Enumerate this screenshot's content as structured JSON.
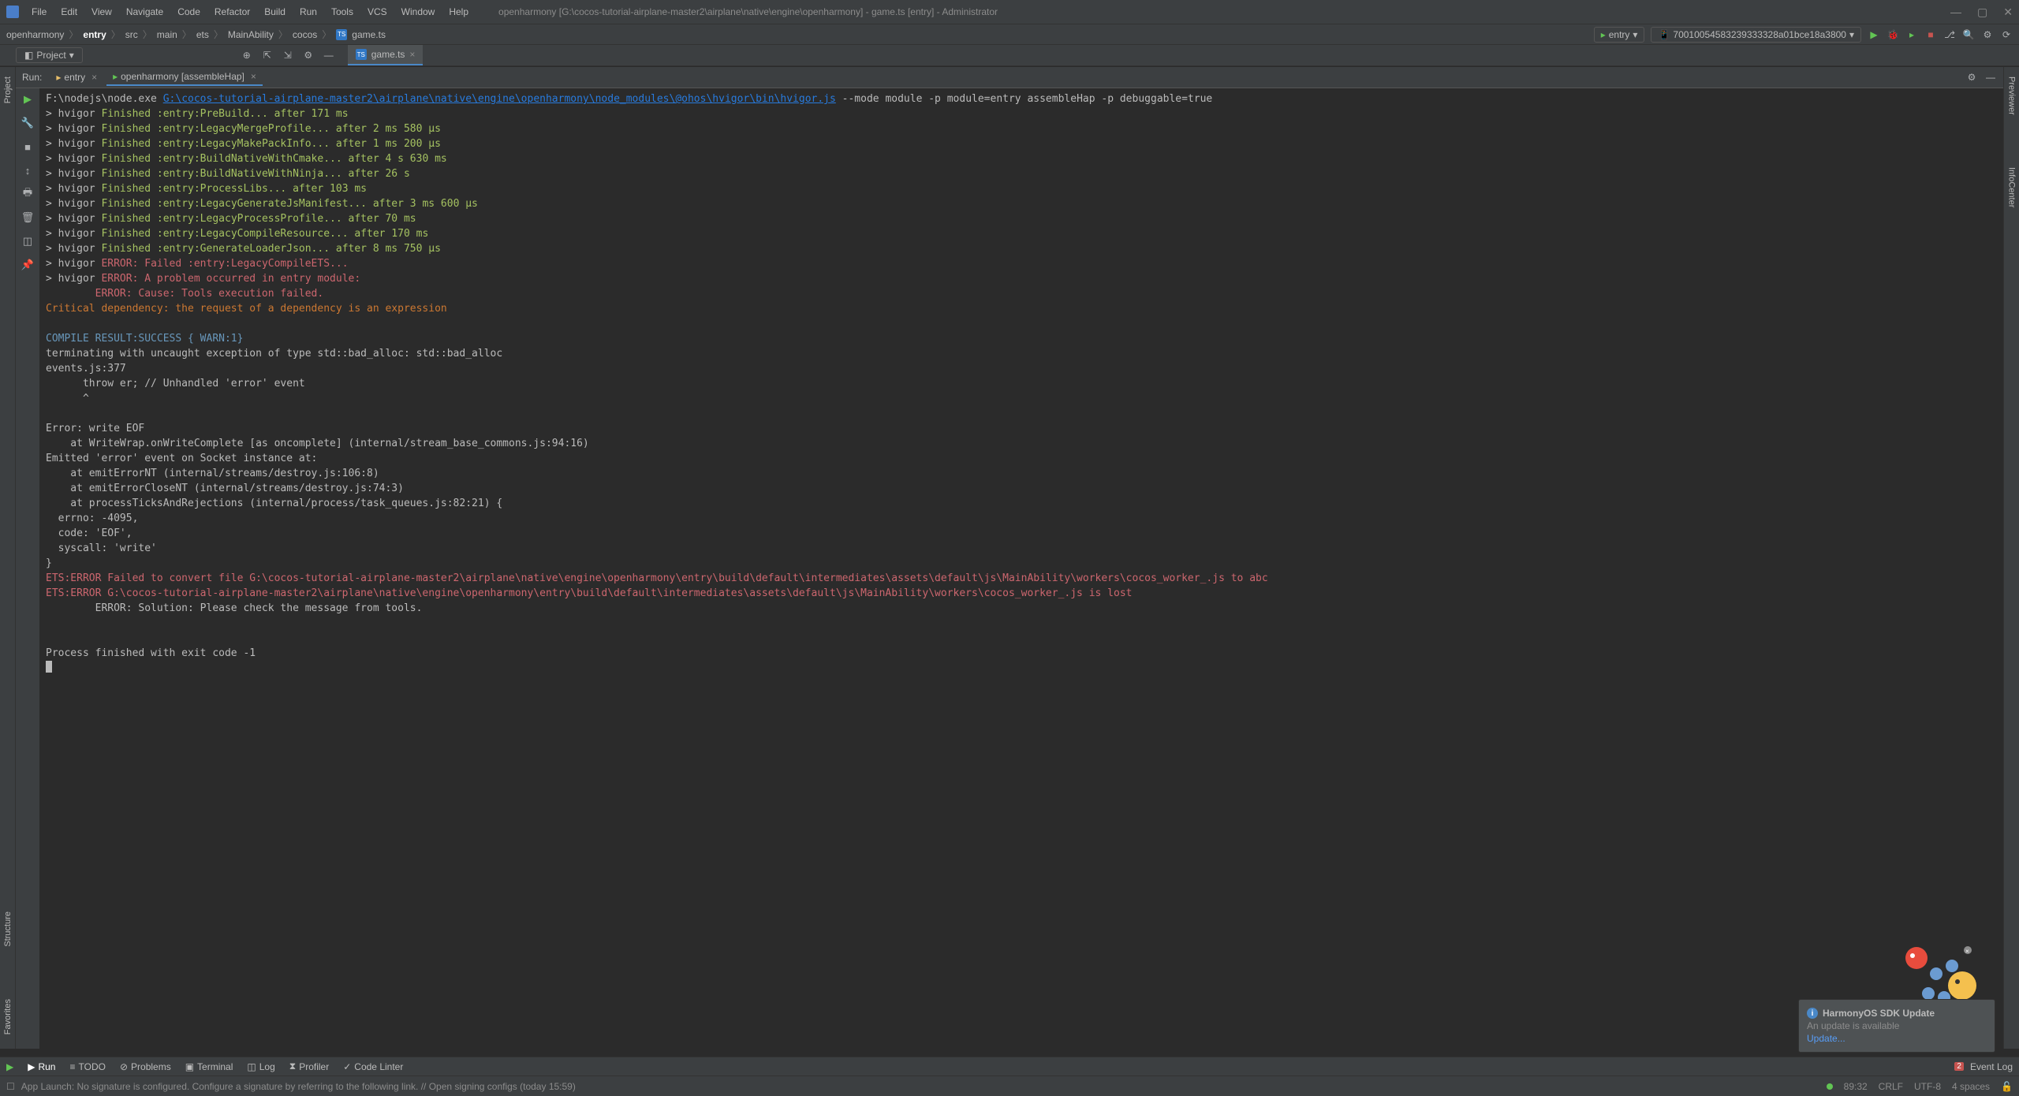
{
  "title_bar": {
    "project_path": "openharmony [G:\\cocos-tutorial-airplane-master2\\airplane\\native\\engine\\openharmony] - game.ts [entry] - Administrator"
  },
  "menu": [
    "File",
    "Edit",
    "View",
    "Navigate",
    "Code",
    "Refactor",
    "Build",
    "Run",
    "Tools",
    "VCS",
    "Window",
    "Help"
  ],
  "breadcrumb": [
    "openharmony",
    "entry",
    "src",
    "main",
    "ets",
    "MainAbility",
    "cocos",
    "game.ts"
  ],
  "run_configs": {
    "entry_label": "entry",
    "device_label": "70010054583239333328a01bce18a3800"
  },
  "project_selector": "Project",
  "editor_tab": {
    "label": "game.ts"
  },
  "run_panel": {
    "label": "Run:",
    "tabs": [
      {
        "label": "entry"
      },
      {
        "label": "openharmony [assembleHap]"
      }
    ]
  },
  "side_left": [
    "Project",
    "Structure",
    "Favorites"
  ],
  "side_right": [
    "Previewer",
    "InfoCenter"
  ],
  "console": {
    "cmd_pre": "F:\\nodejs\\node.exe ",
    "cmd_link": "G:\\cocos-tutorial-airplane-master2\\airplane\\native\\engine\\openharmony\\node_modules\\@ohos\\hvigor\\bin\\hvigor.js",
    "cmd_post": " --mode module -p module=entry assembleHap -p debuggable=true",
    "lines": [
      {
        "p": "> hvigor ",
        "f": "Finished :entry:PreBuild... after 171 ms"
      },
      {
        "p": "> hvigor ",
        "f": "Finished :entry:LegacyMergeProfile... after 2 ms 580 μs"
      },
      {
        "p": "> hvigor ",
        "f": "Finished :entry:LegacyMakePackInfo... after 1 ms 200 μs"
      },
      {
        "p": "> hvigor ",
        "f": "Finished :entry:BuildNativeWithCmake... after 4 s 630 ms"
      },
      {
        "p": "> hvigor ",
        "f": "Finished :entry:BuildNativeWithNinja... after 26 s"
      },
      {
        "p": "> hvigor ",
        "f": "Finished :entry:ProcessLibs... after 103 ms"
      },
      {
        "p": "> hvigor ",
        "f": "Finished :entry:LegacyGenerateJsManifest... after 3 ms 600 μs"
      },
      {
        "p": "> hvigor ",
        "f": "Finished :entry:LegacyProcessProfile... after 70 ms"
      },
      {
        "p": "> hvigor ",
        "f": "Finished :entry:LegacyCompileResource... after 170 ms"
      },
      {
        "p": "> hvigor ",
        "f": "Finished :entry:GenerateLoaderJson... after 8 ms 750 μs"
      }
    ],
    "err1_p": "> hvigor ",
    "err1": "ERROR: Failed :entry:LegacyCompileETS...",
    "err2_p": "> hvigor ",
    "err2": "ERROR: A problem occurred in entry module:",
    "err3": "        ERROR: Cause: Tools execution failed.",
    "warn1": "Critical dependency: the request of a dependency is an expression",
    "compile_result": "COMPILE RESULT:SUCCESS { WARN:1}",
    "term1": "terminating with uncaught exception of type std::bad_alloc: std::bad_alloc",
    "term2": "events.js:377",
    "term3": "      throw er; // Unhandled 'error' event",
    "term4": "      ^",
    "term5": "Error: write EOF",
    "term6": "    at WriteWrap.onWriteComplete [as oncomplete] (internal/stream_base_commons.js:94:16)",
    "term7": "Emitted 'error' event on Socket instance at:",
    "term8": "    at emitErrorNT (internal/streams/destroy.js:106:8)",
    "term9": "    at emitErrorCloseNT (internal/streams/destroy.js:74:3)",
    "term10": "    at processTicksAndRejections (internal/process/task_queues.js:82:21) {",
    "term11": "  errno: -4095,",
    "term12": "  code: 'EOF',",
    "term13": "  syscall: 'write'",
    "term14": "}",
    "ets1": "ETS:ERROR Failed to convert file G:\\cocos-tutorial-airplane-master2\\airplane\\native\\engine\\openharmony\\entry\\build\\default\\intermediates\\assets\\default\\js\\MainAbility\\workers\\cocos_worker_.js to abc",
    "ets2": "ETS:ERROR G:\\cocos-tutorial-airplane-master2\\airplane\\native\\engine\\openharmony\\entry\\build\\default\\intermediates\\assets\\default\\js\\MainAbility\\workers\\cocos_worker_.js is lost",
    "sol": "        ERROR: Solution: Please check the message from tools.",
    "exit": "Process finished with exit code -1"
  },
  "bottom_tools": {
    "run": "Run",
    "todo": "TODO",
    "problems": "Problems",
    "terminal": "Terminal",
    "log": "Log",
    "profiler": "Profiler",
    "codelinter": "Code Linter",
    "event_log": "Event Log",
    "event_count": "2"
  },
  "status": {
    "msg": "App Launch: No signature is configured. Configure a signature by referring to the following link. // Open signing configs (today 15:59)",
    "pos": "89:32",
    "sep": "CRLF",
    "enc": "UTF-8",
    "indent": "4 spaces"
  },
  "notification": {
    "title": "HarmonyOS SDK Update",
    "body": "An update is available",
    "link": "Update..."
  }
}
